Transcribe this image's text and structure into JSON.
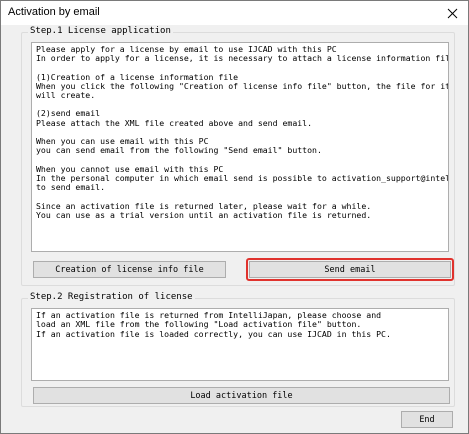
{
  "window": {
    "title": "Activation by email",
    "close_glyph": "✕"
  },
  "step1": {
    "label": "Step.1 License application",
    "paragraphs": [
      [
        "Please apply for a license by email to use IJCAD with this PC",
        "In order to apply for a license, it is necessary to attach a license information file."
      ],
      [
        "(1)Creation of a license information file",
        "When you click the following \"Creation of license info file\" button, the file for it",
        "will create."
      ],
      [
        "(2)send email",
        "Please attach the XML file created above and send email."
      ],
      [
        "When you can use email with this PC",
        "you can send email from the following \"Send email\" button."
      ],
      [
        "When you cannot use email with this PC",
        "In the personal computer in which email send is possible to activation_support@intelli.jp",
        "to send email."
      ],
      [
        "Since an activation file is returned later, please wait for a while.",
        "You can use as a trial version until an activation file is returned."
      ]
    ],
    "create_button": "Creation of license info file",
    "send_button": "Send email"
  },
  "step2": {
    "label": "Step.2 Registration of license",
    "lines": [
      "If an activation file is returned from IntelliJapan, please choose and",
      "load an XML file from the following \"Load activation file\" button.",
      "If an activation file is loaded correctly, you can use IJCAD in this PC."
    ],
    "load_button": "Load activation file"
  },
  "footer": {
    "end_button": "End"
  },
  "colors": {
    "highlight": "#e0332e"
  }
}
